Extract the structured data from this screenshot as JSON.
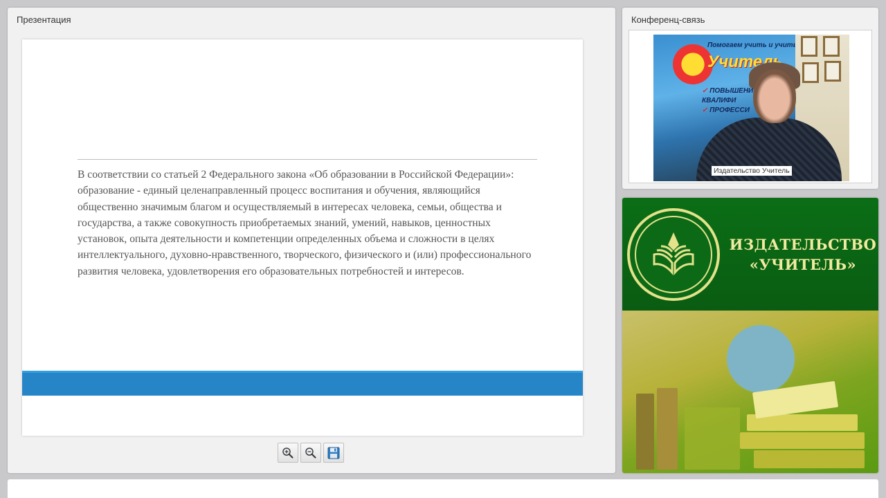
{
  "presentation": {
    "title": "Презентация",
    "slide_text": "В соответствии со статьей 2 Федерального закона «Об образовании в Российской Федерации»: образование - единый целенаправленный процесс воспитания и обучения, являющийся общественно значимым благом и осуществляемый в интересах человека, семьи, общества и государства, а также совокупность приобретаемых знаний, умений, навыков, ценностных установок, опыта деятельности и компетенции определенных объема и сложности в целях интеллектуального, духовно-нравственного, творческого, физического и (или) профессионального развития человека, удовлетворения его образовательных потребностей и интересов.",
    "toolbar": [
      {
        "icon": "zoom-in-icon"
      },
      {
        "icon": "zoom-out-icon"
      },
      {
        "icon": "save-icon"
      }
    ],
    "accent_color": "#2585c6"
  },
  "conference": {
    "title": "Конференц-связь",
    "video_label": "Издательство Учитель",
    "banner": {
      "top_text": "Помогаем учить и учиться",
      "brand": "Учитель",
      "line1": "ПОВЫШЕНИЕ",
      "line2": "КВАЛИФИ",
      "line3": "ПРОФЕССИ"
    }
  },
  "ad": {
    "line1": "ИЗДАТЕЛЬСТВО",
    "line2": "«УЧИТЕЛЬ»",
    "brand_color": "#0b6e16",
    "text_color": "#f2eaa0"
  }
}
